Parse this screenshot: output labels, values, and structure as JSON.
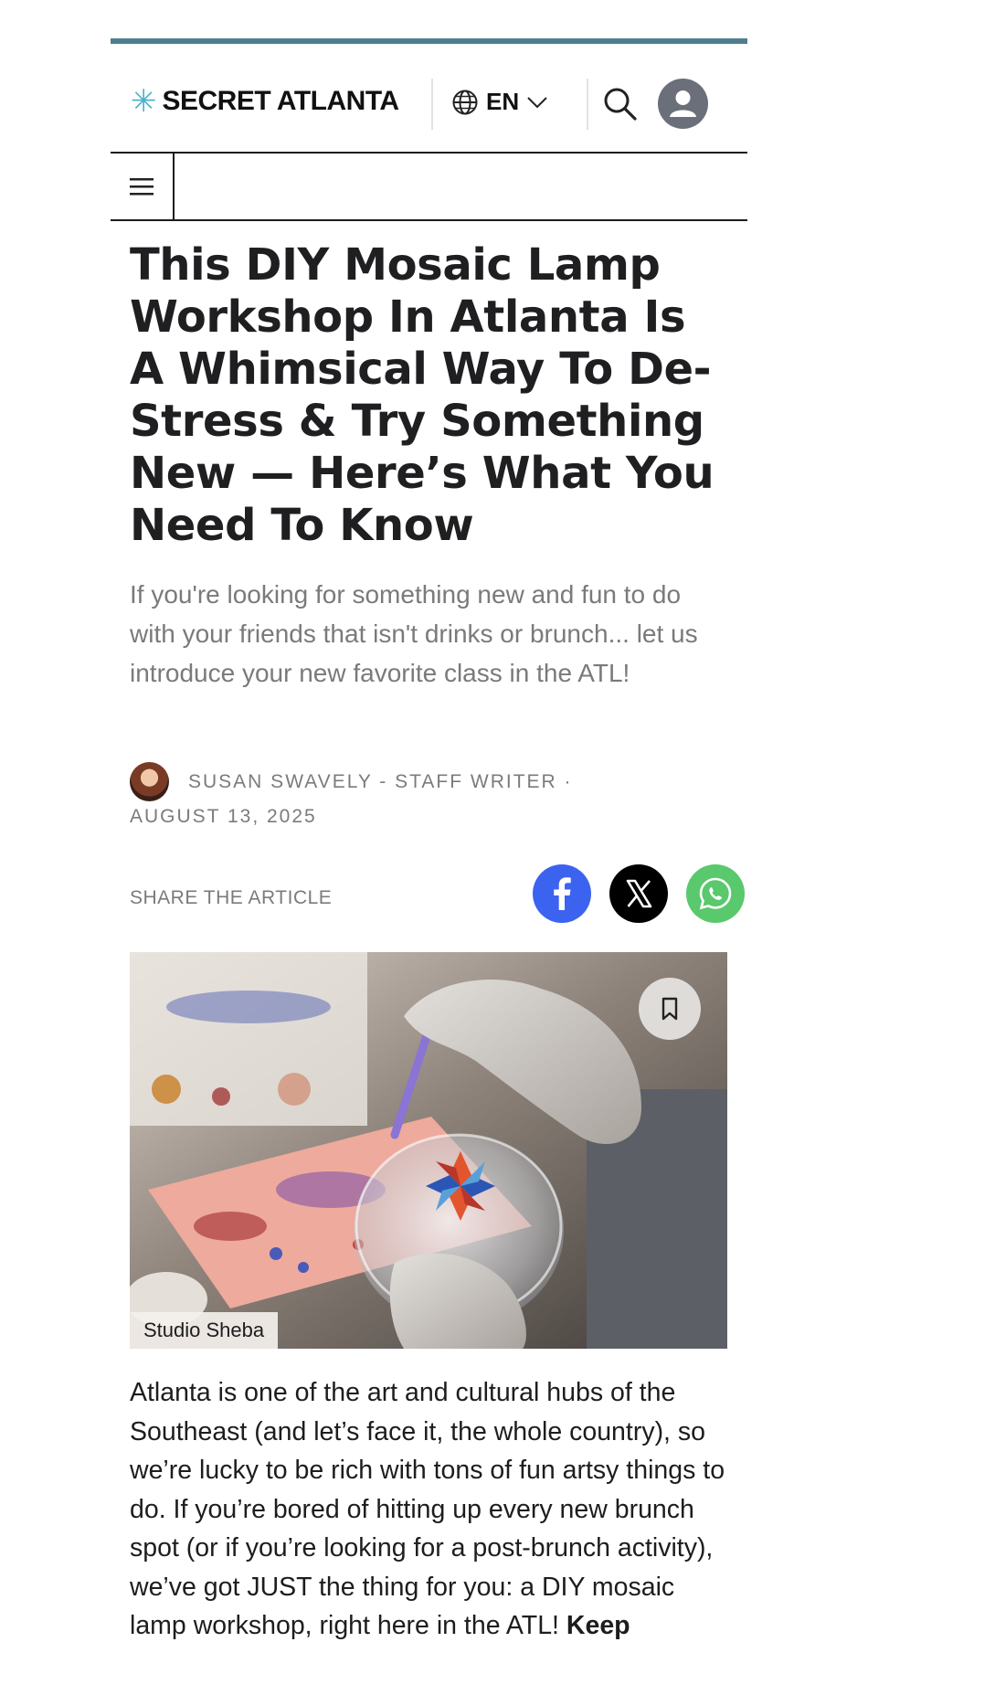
{
  "header": {
    "logo_text": "SECRET ATLANTA",
    "logo_mark": "asterisk-icon",
    "language": "EN",
    "accent_color": "#4e7f8e",
    "logo_accent_color": "#4fb3c8"
  },
  "article": {
    "headline": "This DIY Mosaic Lamp Workshop In Atlanta Is A Whimsical Way To De-Stress & Try Something New — Here’s What You Need To Know",
    "dek": "If you're looking for something new and fun to do with your friends that isn't drinks or brunch... let us introduce your new favorite class in the ATL!",
    "author_line": "SUSAN SWAVELY - STAFF WRITER  ·",
    "date": "AUGUST 13, 2025",
    "share_label": "SHARE THE ARTICLE",
    "share_buttons": [
      {
        "icon": "facebook-icon",
        "color": "#3b63f0"
      },
      {
        "icon": "x-icon",
        "color": "#000000"
      },
      {
        "icon": "whatsapp-icon",
        "color": "#5ac86c"
      }
    ],
    "image_credit": "Studio Sheba",
    "body_intro": "Atlanta is one of the art and cultural hubs of the Southeast (and let’s face it, the whole country), so we’re lucky to be rich with tons of fun artsy things to do. If you’re bored of hitting up every new brunch spot (or if you’re looking for a post-brunch activity), we’ve got JUST the thing for you: a DIY mosaic lamp workshop, right here in the ATL! ",
    "body_bold": "Keep"
  }
}
